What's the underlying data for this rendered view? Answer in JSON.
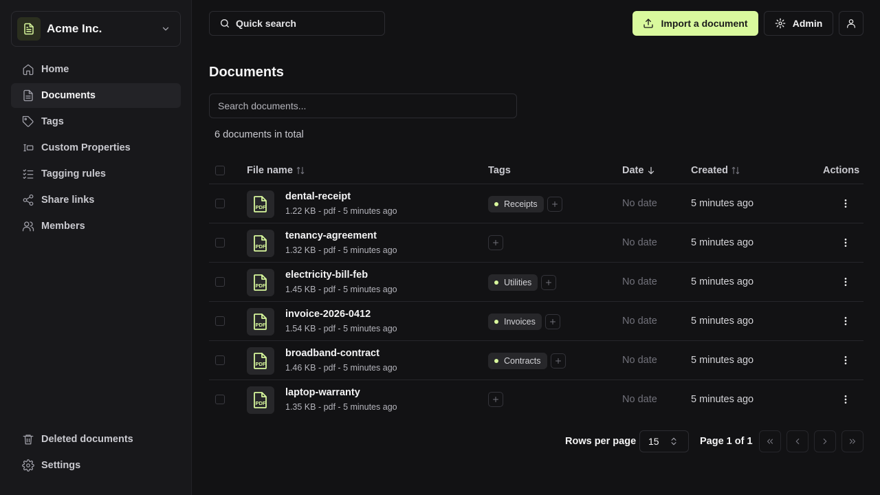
{
  "org": {
    "name": "Acme Inc."
  },
  "nav": {
    "items": [
      {
        "label": "Home",
        "icon": "home-icon"
      },
      {
        "label": "Documents",
        "icon": "document-icon",
        "active": true
      },
      {
        "label": "Tags",
        "icon": "tag-icon"
      },
      {
        "label": "Custom Properties",
        "icon": "properties-icon"
      },
      {
        "label": "Tagging rules",
        "icon": "list-check-icon"
      },
      {
        "label": "Share links",
        "icon": "share-icon"
      },
      {
        "label": "Members",
        "icon": "users-icon"
      }
    ],
    "bottom": [
      {
        "label": "Deleted documents",
        "icon": "trash-icon"
      },
      {
        "label": "Settings",
        "icon": "gear-icon"
      }
    ]
  },
  "topbar": {
    "quick_search": "Quick search",
    "import_button": "Import a document",
    "admin_button": "Admin"
  },
  "page": {
    "title": "Documents",
    "search_placeholder": "Search documents...",
    "total": "6 documents in total"
  },
  "table": {
    "headers": {
      "file_name": "File name",
      "tags": "Tags",
      "date": "Date",
      "created": "Created",
      "actions": "Actions"
    },
    "rows": [
      {
        "name": "dental-receipt",
        "meta": "1.22 KB - pdf - 5 minutes ago",
        "tags": [
          "Receipts"
        ],
        "date": "No date",
        "created": "5 minutes ago"
      },
      {
        "name": "tenancy-agreement",
        "meta": "1.32 KB - pdf - 5 minutes ago",
        "tags": [],
        "date": "No date",
        "created": "5 minutes ago"
      },
      {
        "name": "electricity-bill-feb",
        "meta": "1.45 KB - pdf - 5 minutes ago",
        "tags": [
          "Utilities"
        ],
        "date": "No date",
        "created": "5 minutes ago"
      },
      {
        "name": "invoice-2026-0412",
        "meta": "1.54 KB - pdf - 5 minutes ago",
        "tags": [
          "Invoices"
        ],
        "date": "No date",
        "created": "5 minutes ago"
      },
      {
        "name": "broadband-contract",
        "meta": "1.46 KB - pdf - 5 minutes ago",
        "tags": [
          "Contracts"
        ],
        "date": "No date",
        "created": "5 minutes ago"
      },
      {
        "name": "laptop-warranty",
        "meta": "1.35 KB - pdf - 5 minutes ago",
        "tags": [],
        "date": "No date",
        "created": "5 minutes ago"
      }
    ],
    "file_icon_label": "PDF"
  },
  "pagination": {
    "rows_per_page_label": "Rows per page",
    "rows_per_page": "15",
    "page_info": "Page 1 of 1"
  },
  "colors": {
    "accent": "#d9f99d",
    "background": "#121214",
    "sidebar": "#18181b"
  }
}
